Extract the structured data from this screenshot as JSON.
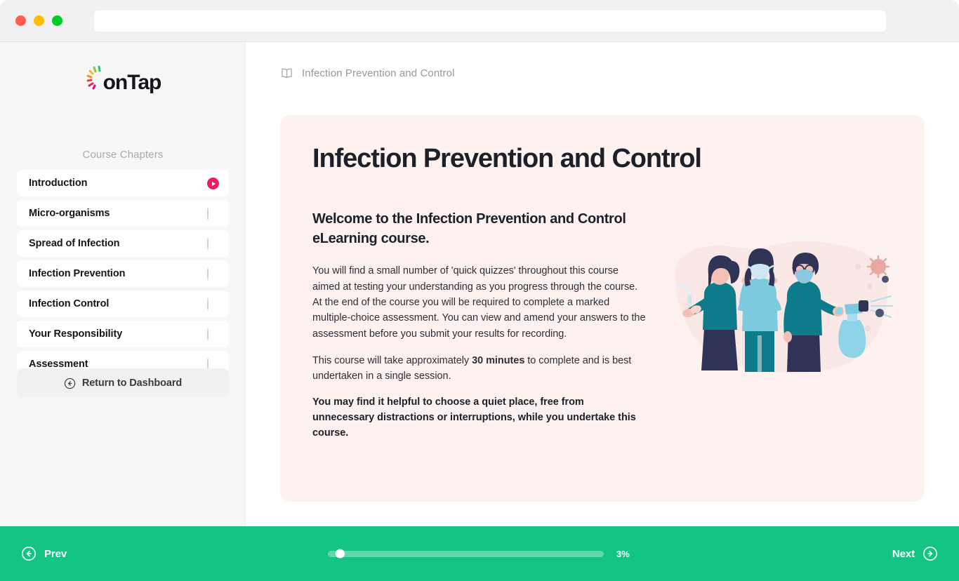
{
  "browser": {
    "traffic_lights": [
      "close",
      "minimize",
      "maximize"
    ],
    "url_value": "",
    "url_placeholder": ""
  },
  "sidebar": {
    "logo_text": "onTap",
    "logo_icon": "ontap-burst-icon",
    "section_title": "Course Chapters",
    "chapters": [
      {
        "label": "Introduction",
        "status": "playing"
      },
      {
        "label": "Micro-organisms",
        "status": "incomplete"
      },
      {
        "label": "Spread of Infection",
        "status": "incomplete"
      },
      {
        "label": "Infection Prevention",
        "status": "incomplete"
      },
      {
        "label": "Infection Control",
        "status": "incomplete"
      },
      {
        "label": "Your Responsibility",
        "status": "incomplete"
      },
      {
        "label": "Assessment",
        "status": "incomplete"
      }
    ],
    "return_button": {
      "label": "Return to Dashboard",
      "icon": "arrow-left-circle-icon"
    }
  },
  "main": {
    "breadcrumb": {
      "icon": "open-book-icon",
      "label": "Infection Prevention and Control"
    },
    "hero": {
      "title": "Infection Prevention and Control",
      "subtitle": "Welcome to the Infection Prevention and Control eLearning course.",
      "paragraph1_part1": "You will find a small number of 'quick quizzes' throughout this course aimed at testing your understanding as you progress through the course. At the end of the course you will be required to complete a marked multiple-choice assessment. You can view and amend your answers to the assessment before you submit your results for recording.",
      "paragraph2_part1": "This course will take approximately ",
      "paragraph2_bold": "30 minutes",
      "paragraph2_part2": " to complete and is best undertaken in a single session.",
      "paragraph3": "You may find it helpful to choose a quiet place, free from unnecessary distractions or interruptions, while you undertake this course.",
      "illustration_name": "infection-prevention-people-illustration"
    }
  },
  "bottom_bar": {
    "prev_label": "Prev",
    "prev_icon": "arrow-left-circle-icon",
    "next_label": "Next",
    "next_icon": "arrow-right-circle-icon",
    "progress_percent_label": "3%",
    "progress_percent_value": 3
  },
  "colors": {
    "accent_green": "#14c484",
    "accent_pink": "#ec1e63",
    "hero_card_bg": "#fdf2f0",
    "sidebar_bg": "#f7f7f7",
    "text_dark": "#1d2029"
  }
}
